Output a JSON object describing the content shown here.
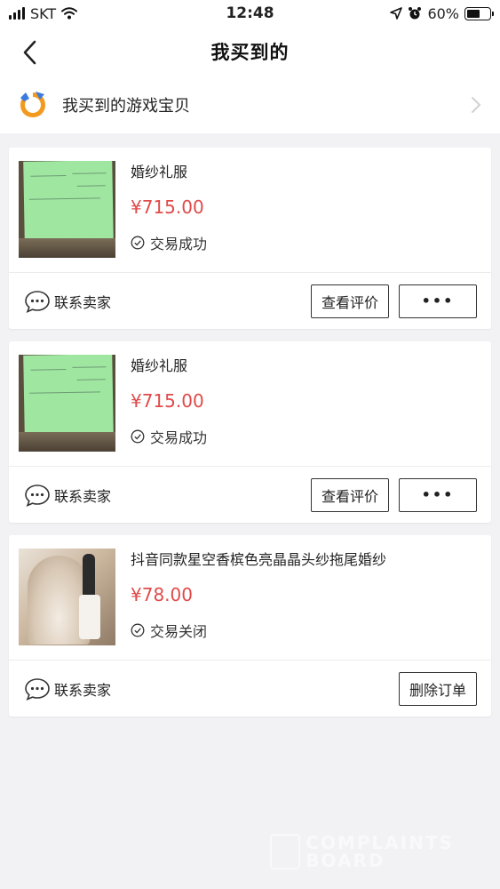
{
  "status_bar": {
    "carrier": "SKT",
    "time": "12:48",
    "battery": "60%",
    "battery_level": 0.6
  },
  "nav": {
    "title": "我买到的",
    "back_icon": "chevron-left-icon"
  },
  "game_row": {
    "label": "我买到的游戏宝贝",
    "logo_icon": "game-logo-icon",
    "chevron_icon": "chevron-right-icon"
  },
  "orders": [
    {
      "image": "handwritten-note-photo",
      "name": "婚纱礼服",
      "price": "¥715.00",
      "status": "交易成功",
      "contact_label": "联系卖家",
      "review_label": "查看评价",
      "more_label": "•••"
    },
    {
      "image": "handwritten-note-photo",
      "name": "婚纱礼服",
      "price": "¥715.00",
      "status": "交易成功",
      "contact_label": "联系卖家",
      "review_label": "查看评价",
      "more_label": "•••"
    },
    {
      "image": "wedding-dress-photo",
      "name": "抖音同款星空香槟色亮晶晶头纱拖尾婚纱",
      "price": "¥78.00",
      "status": "交易关闭",
      "contact_label": "联系卖家",
      "delete_label": "删除订单"
    }
  ],
  "watermark": {
    "line1": "COMPLAINTS",
    "line2": "BOARD"
  },
  "colors": {
    "price": "#e04a4a",
    "background": "#f2f2f4",
    "card": "#ffffff"
  }
}
